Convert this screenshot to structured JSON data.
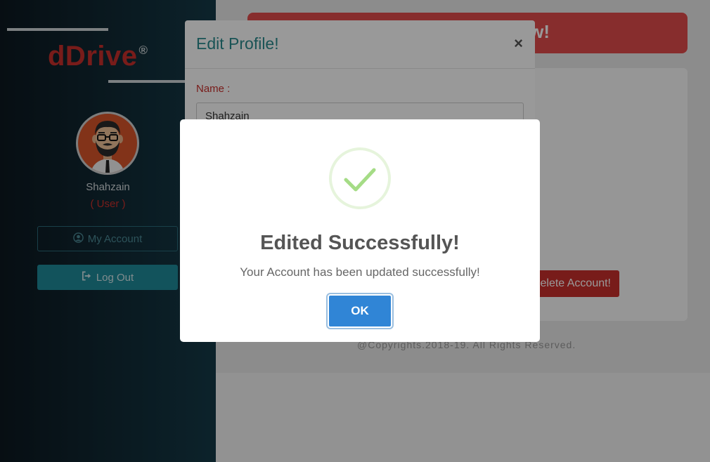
{
  "sidebar": {
    "logo_text": "dDrive",
    "logo_mark": "®",
    "username": "Shahzain",
    "role": "( User )",
    "my_account_label": "My Account",
    "my_account_icon": "user-circle-icon",
    "logout_label": "Log Out",
    "logout_icon": "sign-out-icon"
  },
  "main": {
    "banner_text": "w!",
    "delete_button_label": "elete Account!",
    "copyright": "@Copyrights.2018-19. All Rights Reserved."
  },
  "edit_modal": {
    "title": "Edit Profile!",
    "close_glyph": "×",
    "name_label": "Name :",
    "name_value": "Shahzain"
  },
  "alert": {
    "icon": "success-check-icon",
    "title": "Edited Successfully!",
    "text": "Your Account has been updated successfully!",
    "ok_label": "OK"
  },
  "colors": {
    "brand_red": "#c9302c",
    "teal": "#1f8a99",
    "confirm_blue": "#3085d6",
    "success_green": "#a5dc86"
  }
}
